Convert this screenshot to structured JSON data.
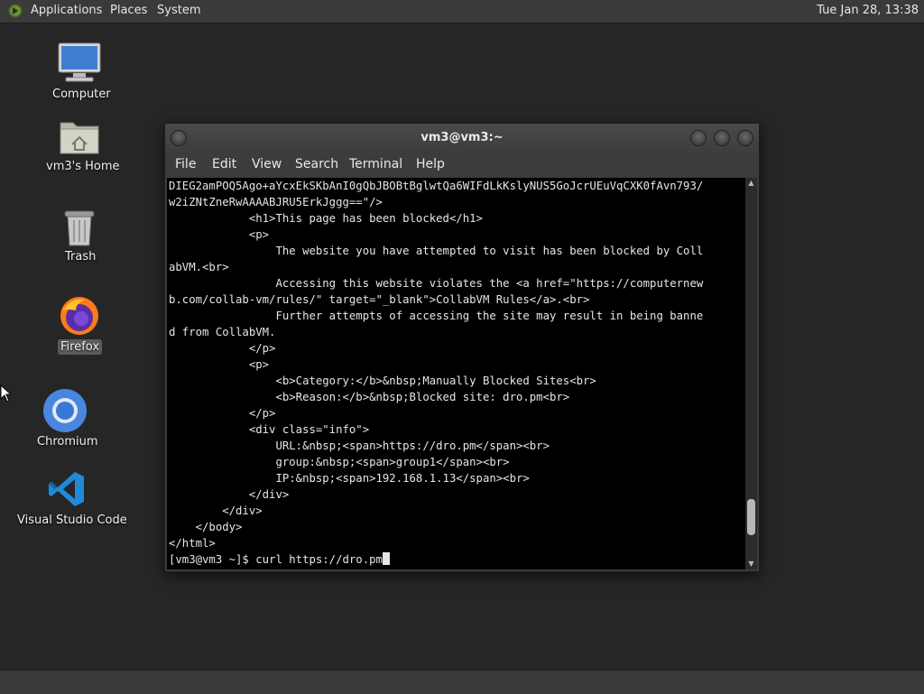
{
  "top_panel": {
    "menus": [
      "Applications",
      "Places",
      "System"
    ],
    "clock": "Tue Jan 28, 13:38"
  },
  "desktop": {
    "icons": [
      {
        "label": "Computer",
        "icon": "computer-icon"
      },
      {
        "label": "vm3's Home",
        "icon": "home-folder-icon"
      },
      {
        "label": "Trash",
        "icon": "trash-icon"
      },
      {
        "label": "Firefox",
        "icon": "firefox-icon"
      },
      {
        "label": "Chromium",
        "icon": "chromium-icon"
      },
      {
        "label": "Visual Studio Code",
        "icon": "vscode-icon"
      }
    ]
  },
  "terminal": {
    "title": "vm3@vm3:~",
    "menu": [
      "File",
      "Edit",
      "View",
      "Search",
      "Terminal",
      "Help"
    ],
    "lines": [
      "DIEG2amPOQ5Ago+aYcxEkSKbAnI0gQbJBOBtBglwtQa6WIFdLkKslyNUS5GoJcrUEuVqCXK0fAvn793/",
      "w2iZNtZneRwAAAABJRU5ErkJggg==\"/>",
      "            <h1>This page has been blocked</h1>",
      "            <p>",
      "                The website you have attempted to visit has been blocked by Coll",
      "abVM.<br>",
      "                Accessing this website violates the <a href=\"https://computernew",
      "b.com/collab-vm/rules/\" target=\"_blank\">CollabVM Rules</a>.<br>",
      "                Further attempts of accessing the site may result in being banne",
      "d from CollabVM.",
      "            </p>",
      "            <p>",
      "                <b>Category:</b>&nbsp;Manually Blocked Sites<br>",
      "                <b>Reason:</b>&nbsp;Blocked site: dro.pm<br>",
      "            </p>",
      "            <div class=\"info\">",
      "                URL:&nbsp;<span>https://dro.pm</span><br>",
      "                group:&nbsp;<span>group1</span><br>",
      "                IP:&nbsp;<span>192.168.1.13</span><br>",
      "            </div>",
      "        </div>",
      "    </body>",
      "</html>"
    ],
    "prompt": "[vm3@vm3 ~]$ curl https://dro.pm",
    "scroll_position": 0.93
  },
  "colors": {
    "panel_bg": "#3a3a3a",
    "desktop_bg": "#262626",
    "terminal_bg": "#000000",
    "terminal_fg": "#e6e6e6"
  }
}
